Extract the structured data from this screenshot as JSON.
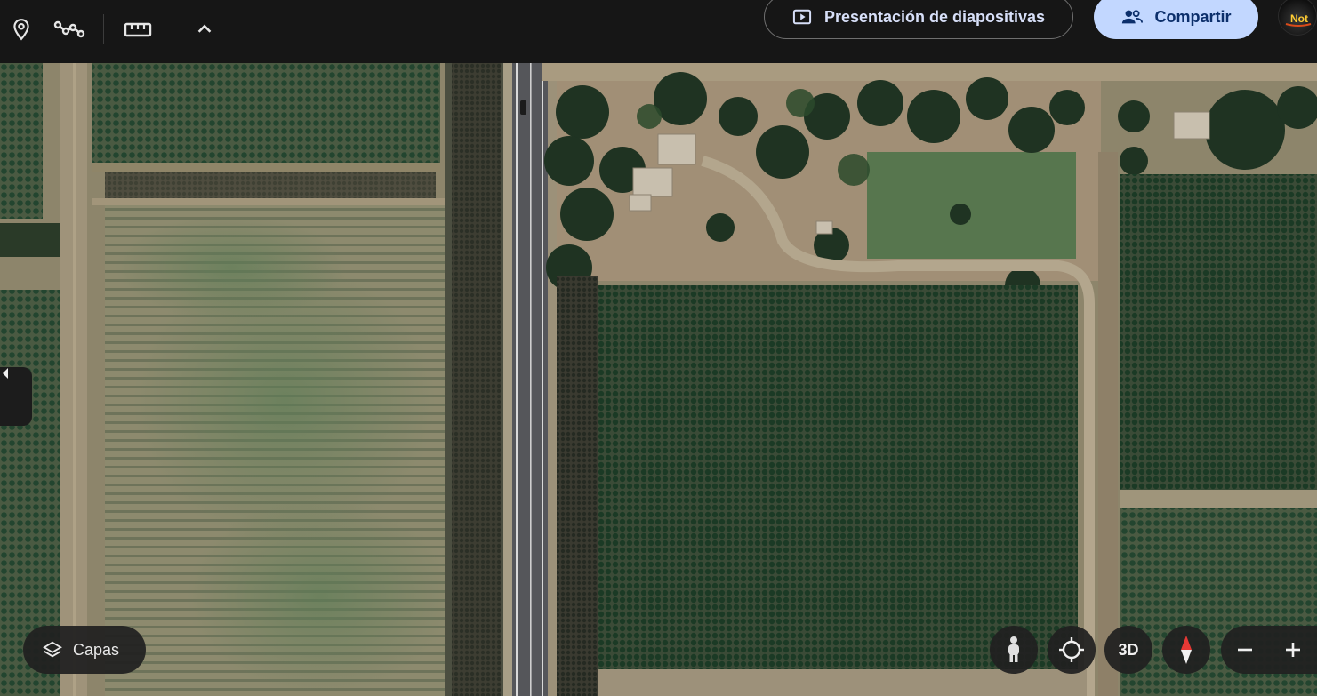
{
  "toolbar": {
    "icons": [
      "place-marker-icon",
      "path-icon",
      "ruler-icon",
      "chevron-up-icon"
    ],
    "slideshow_label": "Presentación de diapositivas",
    "share_label": "Compartir",
    "avatar_text": "Not"
  },
  "map_controls": {
    "layers_label": "Capas",
    "three_d_label": "3D"
  },
  "colors": {
    "toolbar_bg": "#161616",
    "share_bg": "#c2d7ff",
    "share_text": "#0c2f6b",
    "slides_text": "#d7dff8",
    "compass_red": "#e53935"
  }
}
